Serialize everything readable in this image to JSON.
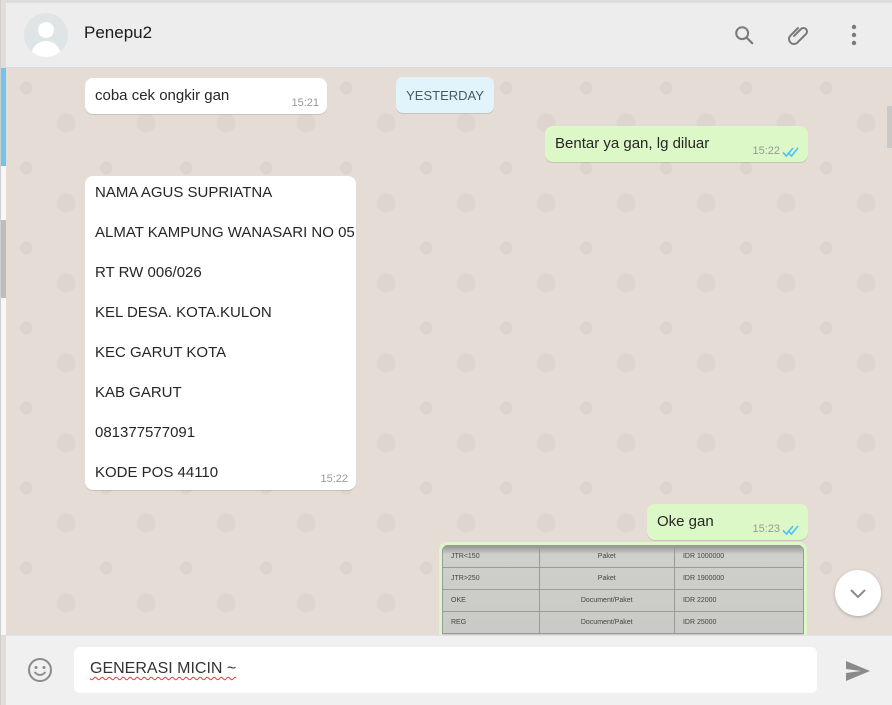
{
  "header": {
    "contact_name": "Penepu2",
    "icons": [
      "search-icon",
      "attach-icon",
      "menu-icon"
    ]
  },
  "chat": {
    "date_separator": "YESTERDAY",
    "messages": [
      {
        "direction": "in",
        "text": "coba cek ongkir gan",
        "time": "15:21"
      },
      {
        "direction": "out",
        "text": "Bentar ya gan, lg diluar",
        "time": "15:22",
        "status": "read"
      },
      {
        "direction": "in",
        "lines": [
          "NAMA AGUS SUPRIATNA",
          "ALMAT KAMPUNG WANASARI NO 05",
          "RT RW 006/026",
          "KEL DESA. KOTA.KULON",
          "KEC GARUT KOTA",
          "KAB GARUT",
          "081377577091",
          "KODE POS 44110"
        ],
        "time": "15:22"
      },
      {
        "direction": "out",
        "text": "Oke gan",
        "time": "15:23",
        "status": "read"
      },
      {
        "direction": "out",
        "type": "image",
        "image_table": [
          [
            "JTR<150",
            "Paket",
            "IDR 1000000"
          ],
          [
            "JTR>250",
            "Paket",
            "IDR 1900000"
          ],
          [
            "OKE",
            "Document/Paket",
            "IDR 22000"
          ],
          [
            "REG",
            "Document/Paket",
            "IDR 25000"
          ]
        ]
      }
    ]
  },
  "composer": {
    "value": "GENERASI MICIN ~",
    "icons": [
      "emoji-icon",
      "send-icon"
    ]
  },
  "colors": {
    "chat_bg": "#e5ddd5",
    "outgoing_bubble": "#dcf8c6",
    "incoming_bubble": "#ffffff",
    "read_ticks": "#4fc3f7",
    "header_bg": "#ededed"
  }
}
